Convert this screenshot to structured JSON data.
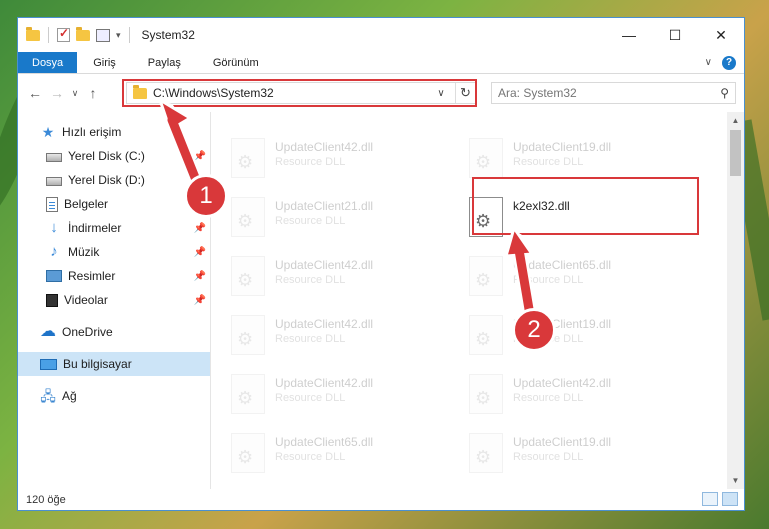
{
  "window": {
    "title": "System32",
    "controls": {
      "minimize": "—",
      "maximize": "☐",
      "close": "✕"
    }
  },
  "ribbon": {
    "tabs": [
      "Dosya",
      "Giriş",
      "Paylaş",
      "Görünüm"
    ],
    "expand_icon": "chevron-down-icon",
    "help_icon": "?"
  },
  "address": {
    "path": "C:\\Windows\\System32",
    "search_placeholder": "Ara: System32"
  },
  "nav": {
    "quick_access": "Hızlı erişim",
    "items": [
      {
        "label": "Yerel Disk (C:)",
        "icon": "drive-icon",
        "pinned": true
      },
      {
        "label": "Yerel Disk (D:)",
        "icon": "drive-icon",
        "pinned": false
      },
      {
        "label": "Belgeler",
        "icon": "documents-icon",
        "pinned": true
      },
      {
        "label": "İndirmeler",
        "icon": "downloads-icon",
        "pinned": true
      },
      {
        "label": "Müzik",
        "icon": "music-icon",
        "pinned": true
      },
      {
        "label": "Resimler",
        "icon": "pictures-icon",
        "pinned": true
      },
      {
        "label": "Videolar",
        "icon": "videos-icon",
        "pinned": true
      }
    ],
    "onedrive": "OneDrive",
    "this_pc": "Bu bilgisayar",
    "network": "Ağ"
  },
  "files": [
    {
      "name": "UpdateClient42.dll",
      "type": "Resource DLL"
    },
    {
      "name": "UpdateClient19.dll",
      "type": "Resource DLL"
    },
    {
      "name": "UpdateClient21.dll",
      "type": "Resource DLL"
    },
    {
      "name": "k2exl32.dll",
      "type": ""
    },
    {
      "name": "UpdateClient42.dll",
      "type": "Resource DLL"
    },
    {
      "name": "UpdateClient65.dll",
      "type": "Resource DLL"
    },
    {
      "name": "UpdateClient42.dll",
      "type": "Resource DLL"
    },
    {
      "name": "UpdateClient19.dll",
      "type": "Resource DLL"
    },
    {
      "name": "UpdateClient42.dll",
      "type": "Resource DLL"
    },
    {
      "name": "UpdateClient42.dll",
      "type": "Resource DLL"
    },
    {
      "name": "UpdateClient65.dll",
      "type": "Resource DLL"
    },
    {
      "name": "UpdateClient19.dll",
      "type": "Resource DLL"
    }
  ],
  "status": {
    "count": "120 öğe"
  },
  "annotations": {
    "step1": "1",
    "step2": "2"
  },
  "colors": {
    "accent": "#1979ca",
    "highlight": "#d9383a",
    "selection": "#cce4f7"
  }
}
